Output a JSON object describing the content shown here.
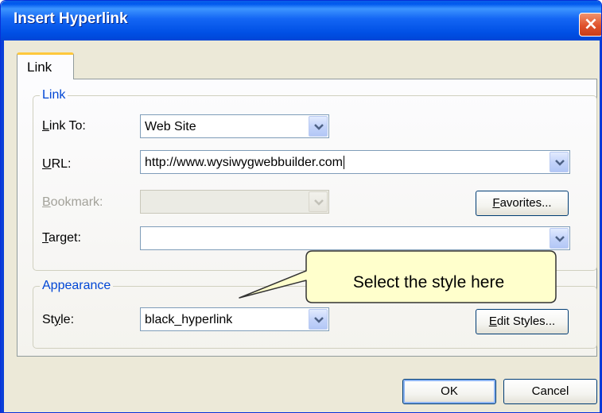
{
  "window": {
    "title": "Insert Hyperlink",
    "close_glyph": "×"
  },
  "tabs": [
    {
      "label": "Link"
    }
  ],
  "link_group": {
    "legend": "Link",
    "link_to": {
      "label_pre": "",
      "label_u": "L",
      "label_post": "ink To:",
      "value": "Web Site"
    },
    "url": {
      "label_pre": "",
      "label_u": "U",
      "label_post": "RL:",
      "value": "http://www.wysiwygwebbuilder.com"
    },
    "bookmark": {
      "label_pre": "",
      "label_u": "B",
      "label_post": "ookmark:",
      "value": ""
    },
    "target": {
      "label_pre": "",
      "label_u": "T",
      "label_post": "arget:",
      "value": ""
    },
    "favorites_button": {
      "pre": "",
      "u": "F",
      "post": "avorites..."
    }
  },
  "appearance_group": {
    "legend": "Appearance",
    "style": {
      "label_pre": "St",
      "label_u": "y",
      "label_post": "le:",
      "value": "black_hyperlink"
    },
    "edit_styles_button": {
      "pre": "",
      "u": "E",
      "post": "dit Styles..."
    }
  },
  "callout": {
    "text": "Select the style here"
  },
  "footer": {
    "ok_label": "OK",
    "cancel_label": "Cancel"
  },
  "colors": {
    "titlebar": "#0058EE",
    "legend_text": "#0046D5",
    "tab_highlight": "#FFC83C",
    "callout_fill": "#FFFFCC",
    "dialog_bg": "#ECE9D8"
  },
  "icons": {
    "close": "close-icon",
    "dropdown": "chevron-down-icon"
  }
}
